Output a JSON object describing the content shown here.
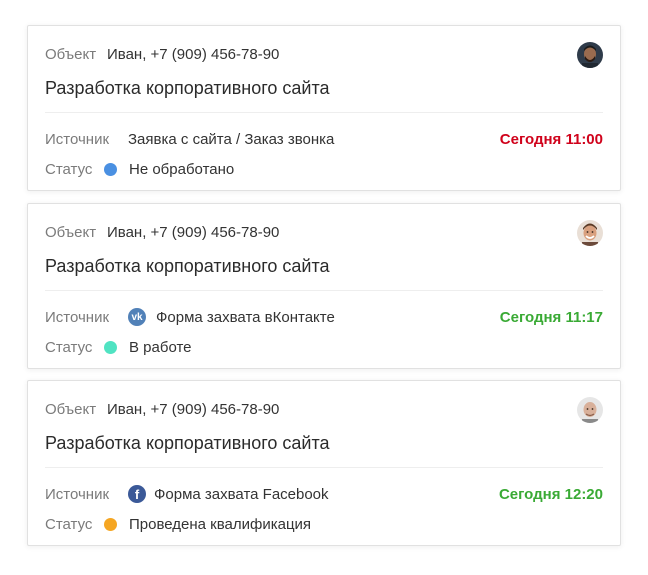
{
  "labels": {
    "object": "Объект",
    "source": "Источник",
    "status": "Статус"
  },
  "cards": [
    {
      "object_value": "Иван, +7 (909) 456-78-90",
      "title": "Разработка корпоративного сайта",
      "source": "Заявка с сайта / Заказ звонка",
      "source_icon": "none",
      "time": "Сегодня 11:00",
      "time_color": "#d0021b",
      "status": "Не обработано",
      "status_color": "#4a90e2",
      "avatar": "avatar-dark-bearded-man"
    },
    {
      "object_value": "Иван, +7 (909) 456-78-90",
      "title": "Разработка корпоративного сайта",
      "source": "Форма захвата вКонтакте",
      "source_icon": "vk-icon",
      "source_icon_glyph": "vk",
      "source_icon_color": "#5181b8",
      "time": "Сегодня 11:17",
      "time_color": "#3aaa35",
      "status": "В работе",
      "status_color": "#50e3c2",
      "avatar": "avatar-smiling-man"
    },
    {
      "object_value": "Иван, +7 (909) 456-78-90",
      "title": "Разработка корпоративного сайта",
      "source": "Форма захвата Facebook",
      "source_icon": "facebook-icon",
      "source_icon_glyph": "f",
      "source_icon_color": "#3b5998",
      "time": "Сегодня 12:20",
      "time_color": "#3aaa35",
      "status": "Проведена квалификация",
      "status_color": "#f5a623",
      "avatar": "avatar-bald-man"
    }
  ]
}
